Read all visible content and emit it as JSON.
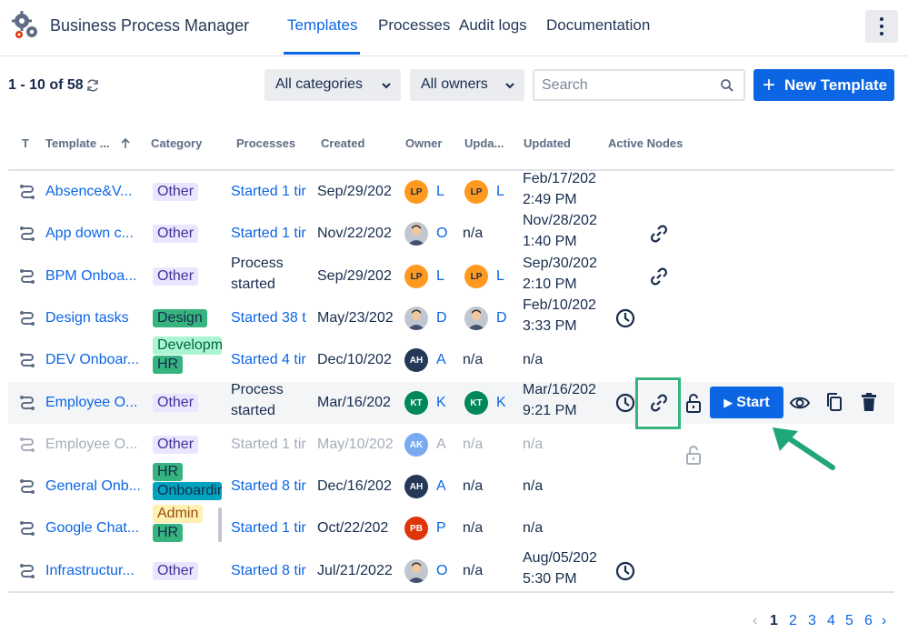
{
  "app": {
    "title": "Business Process Manager"
  },
  "nav": {
    "tabs": [
      "Templates",
      "Processes",
      "Audit logs",
      "Documentation"
    ],
    "active": "Templates"
  },
  "toolbar": {
    "count": "1 - 10 of 58",
    "categories_filter": "All categories",
    "owners_filter": "All owners",
    "search_placeholder": "Search",
    "new_button": "New Template"
  },
  "table": {
    "headers": [
      "T",
      "Template ...",
      "Category",
      "Processes",
      "Created",
      "Owner",
      "Upda...",
      "Updated",
      "Active Nodes"
    ],
    "rows": [
      {
        "name": "Absence&V...",
        "categories": [
          "Other"
        ],
        "processes": [
          "Started 1 tir"
        ],
        "created": "Sep/29/202",
        "owner": "LP",
        "owner_name": "L",
        "updater": "LP",
        "updater_name": "L",
        "updated": [
          "Feb/17/202",
          "2:49 PM"
        ],
        "icons": []
      },
      {
        "name": "App down c...",
        "categories": [
          "Other"
        ],
        "processes": [
          "Started 1 tir"
        ],
        "created": "Nov/22/202",
        "owner": "photo",
        "owner_name": "O",
        "updater": "",
        "updater_name": "n/a",
        "updated": [
          "Nov/28/202",
          "1:40 PM"
        ],
        "icons": [
          "link"
        ]
      },
      {
        "name": "BPM Onboa...",
        "categories": [
          "Other"
        ],
        "processes": [
          "Process",
          "started"
        ],
        "created": "Sep/29/202",
        "owner": "LP",
        "owner_name": "L",
        "updater": "LP",
        "updater_name": "L",
        "updated": [
          "Sep/30/202",
          "2:10 PM"
        ],
        "icons": [
          "link"
        ]
      },
      {
        "name": "Design tasks",
        "categories": [
          "Design"
        ],
        "processes": [
          "Started 38 t"
        ],
        "created": "May/23/202",
        "owner": "photo",
        "owner_name": "D",
        "updater": "photo",
        "updater_name": "D",
        "updated": [
          "Feb/10/202",
          "3:33 PM"
        ],
        "icons": [
          "clock"
        ]
      },
      {
        "name": "DEV Onboar...",
        "categories": [
          "Developm",
          "HR"
        ],
        "processes": [
          "Started 4 tir"
        ],
        "created": "Dec/10/202",
        "owner": "AH",
        "owner_name": "A",
        "updater": "",
        "updater_name": "n/a",
        "updated": [
          "n/a"
        ],
        "icons": []
      },
      {
        "name": "Employee O...",
        "categories": [
          "Other"
        ],
        "processes": [
          "Process",
          "started"
        ],
        "created": "Mar/16/202",
        "owner": "KT",
        "owner_name": "K",
        "updater": "KT",
        "updater_name": "K",
        "updated": [
          "Mar/16/202",
          "9:21 PM"
        ],
        "icons": [
          "clock",
          "link",
          "unlock"
        ]
      },
      {
        "name": "Employee O...",
        "categories": [
          "Other"
        ],
        "processes": [
          "Started 1 tir"
        ],
        "created": "May/10/202",
        "owner": "AK",
        "owner_name": "A",
        "updater": "",
        "updater_name": "n/a",
        "updated": [
          "n/a"
        ],
        "icons": [
          "unlock"
        ]
      },
      {
        "name": "General Onb...",
        "categories": [
          "HR",
          "Onboardir"
        ],
        "processes": [
          "Started 8 tir"
        ],
        "created": "Dec/16/202",
        "owner": "AH",
        "owner_name": "A",
        "updater": "",
        "updater_name": "n/a",
        "updated": [
          "n/a"
        ],
        "icons": []
      },
      {
        "name": "Google Chat...",
        "categories": [
          "Admin",
          "HR"
        ],
        "processes": [
          "Started 1 tir"
        ],
        "created": "Oct/22/202",
        "owner": "PB",
        "owner_name": "P",
        "updater": "",
        "updater_name": "n/a",
        "updated": [
          "n/a"
        ],
        "icons": []
      },
      {
        "name": "Infrastructur...",
        "categories": [
          "Other"
        ],
        "processes": [
          "Started 8 tir"
        ],
        "created": "Jul/21/2022",
        "owner": "photo",
        "owner_name": "O",
        "updater": "",
        "updater_name": "n/a",
        "updated": [
          "Aug/05/202",
          "5:30 PM"
        ],
        "icons": [
          "clock"
        ]
      }
    ],
    "start_label": "Start"
  },
  "pagination": {
    "prev": "‹",
    "pages": [
      "1",
      "2",
      "3",
      "4",
      "5",
      "6"
    ],
    "current": "1",
    "next": "›"
  },
  "colors": {
    "accent": "#0c66e4",
    "highlight": "#36b37e"
  }
}
